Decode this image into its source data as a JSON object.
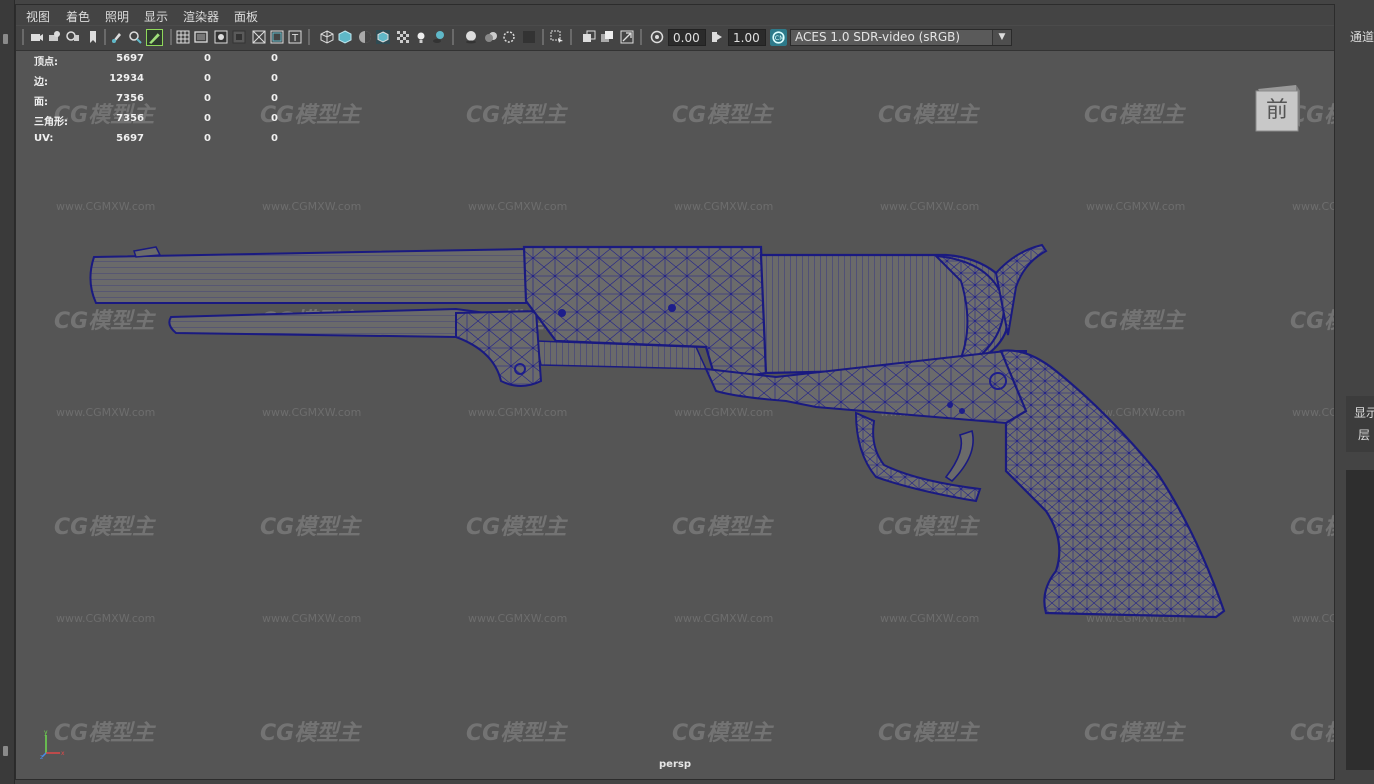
{
  "menu": {
    "items": [
      "视图",
      "着色",
      "照明",
      "显示",
      "渲染器",
      "面板"
    ]
  },
  "toolbar": {
    "exposure_value": "0.00",
    "gamma_value": "1.00",
    "color_space": "ACES 1.0 SDR-video (sRGB)",
    "icons": [
      "camera-select-icon",
      "camera-attr-icon",
      "bookmark-icon",
      "image-plane-icon",
      "grease-pencil-icon",
      "2d-pan-zoom-icon",
      "grid-icon",
      "film-gate-icon",
      "resolution-gate-icon",
      "gate-mask-icon",
      "field-chart-icon",
      "safe-action-icon",
      "safe-title-icon",
      "wireframe-icon",
      "smooth-shade-icon",
      "default-material-icon",
      "wireframe-on-shaded-icon",
      "textured-icon",
      "lights-icon",
      "shadows-icon",
      "screen-space-ao-icon",
      "motion-blur-icon",
      "multisample-aa-icon",
      "depth-of-field-icon",
      "isolate-select-icon",
      "xray-icon",
      "xray-active-icon",
      "xray-joints-icon",
      "backface-culling-icon",
      "exposure-icon",
      "gamma-icon",
      "color-management-icon"
    ]
  },
  "hud": {
    "rows": [
      {
        "label": "顶点:",
        "v1": "5697",
        "v2": "0",
        "v3": "0"
      },
      {
        "label": "边:",
        "v1": "12934",
        "v2": "0",
        "v3": "0"
      },
      {
        "label": "面:",
        "v1": "7356",
        "v2": "0",
        "v3": "0"
      },
      {
        "label": "三角形:",
        "v1": "7356",
        "v2": "0",
        "v3": "0"
      },
      {
        "label": "UV:",
        "v1": "5697",
        "v2": "0",
        "v3": "0"
      }
    ]
  },
  "view_cube": {
    "face_label": "前"
  },
  "camera": {
    "name": "persp"
  },
  "watermark": {
    "logo": "CG模型主",
    "url": "www.CGMXW.com"
  },
  "right_panel": {
    "channel_tab": "通道",
    "display_tab": "显示",
    "layer_tab": "层"
  },
  "colors": {
    "viewport_bg": "#555555",
    "wire_color": "#1e1e8c",
    "mesh_fill": "#6a6a6a",
    "active_icon": "#5fb8c8"
  }
}
